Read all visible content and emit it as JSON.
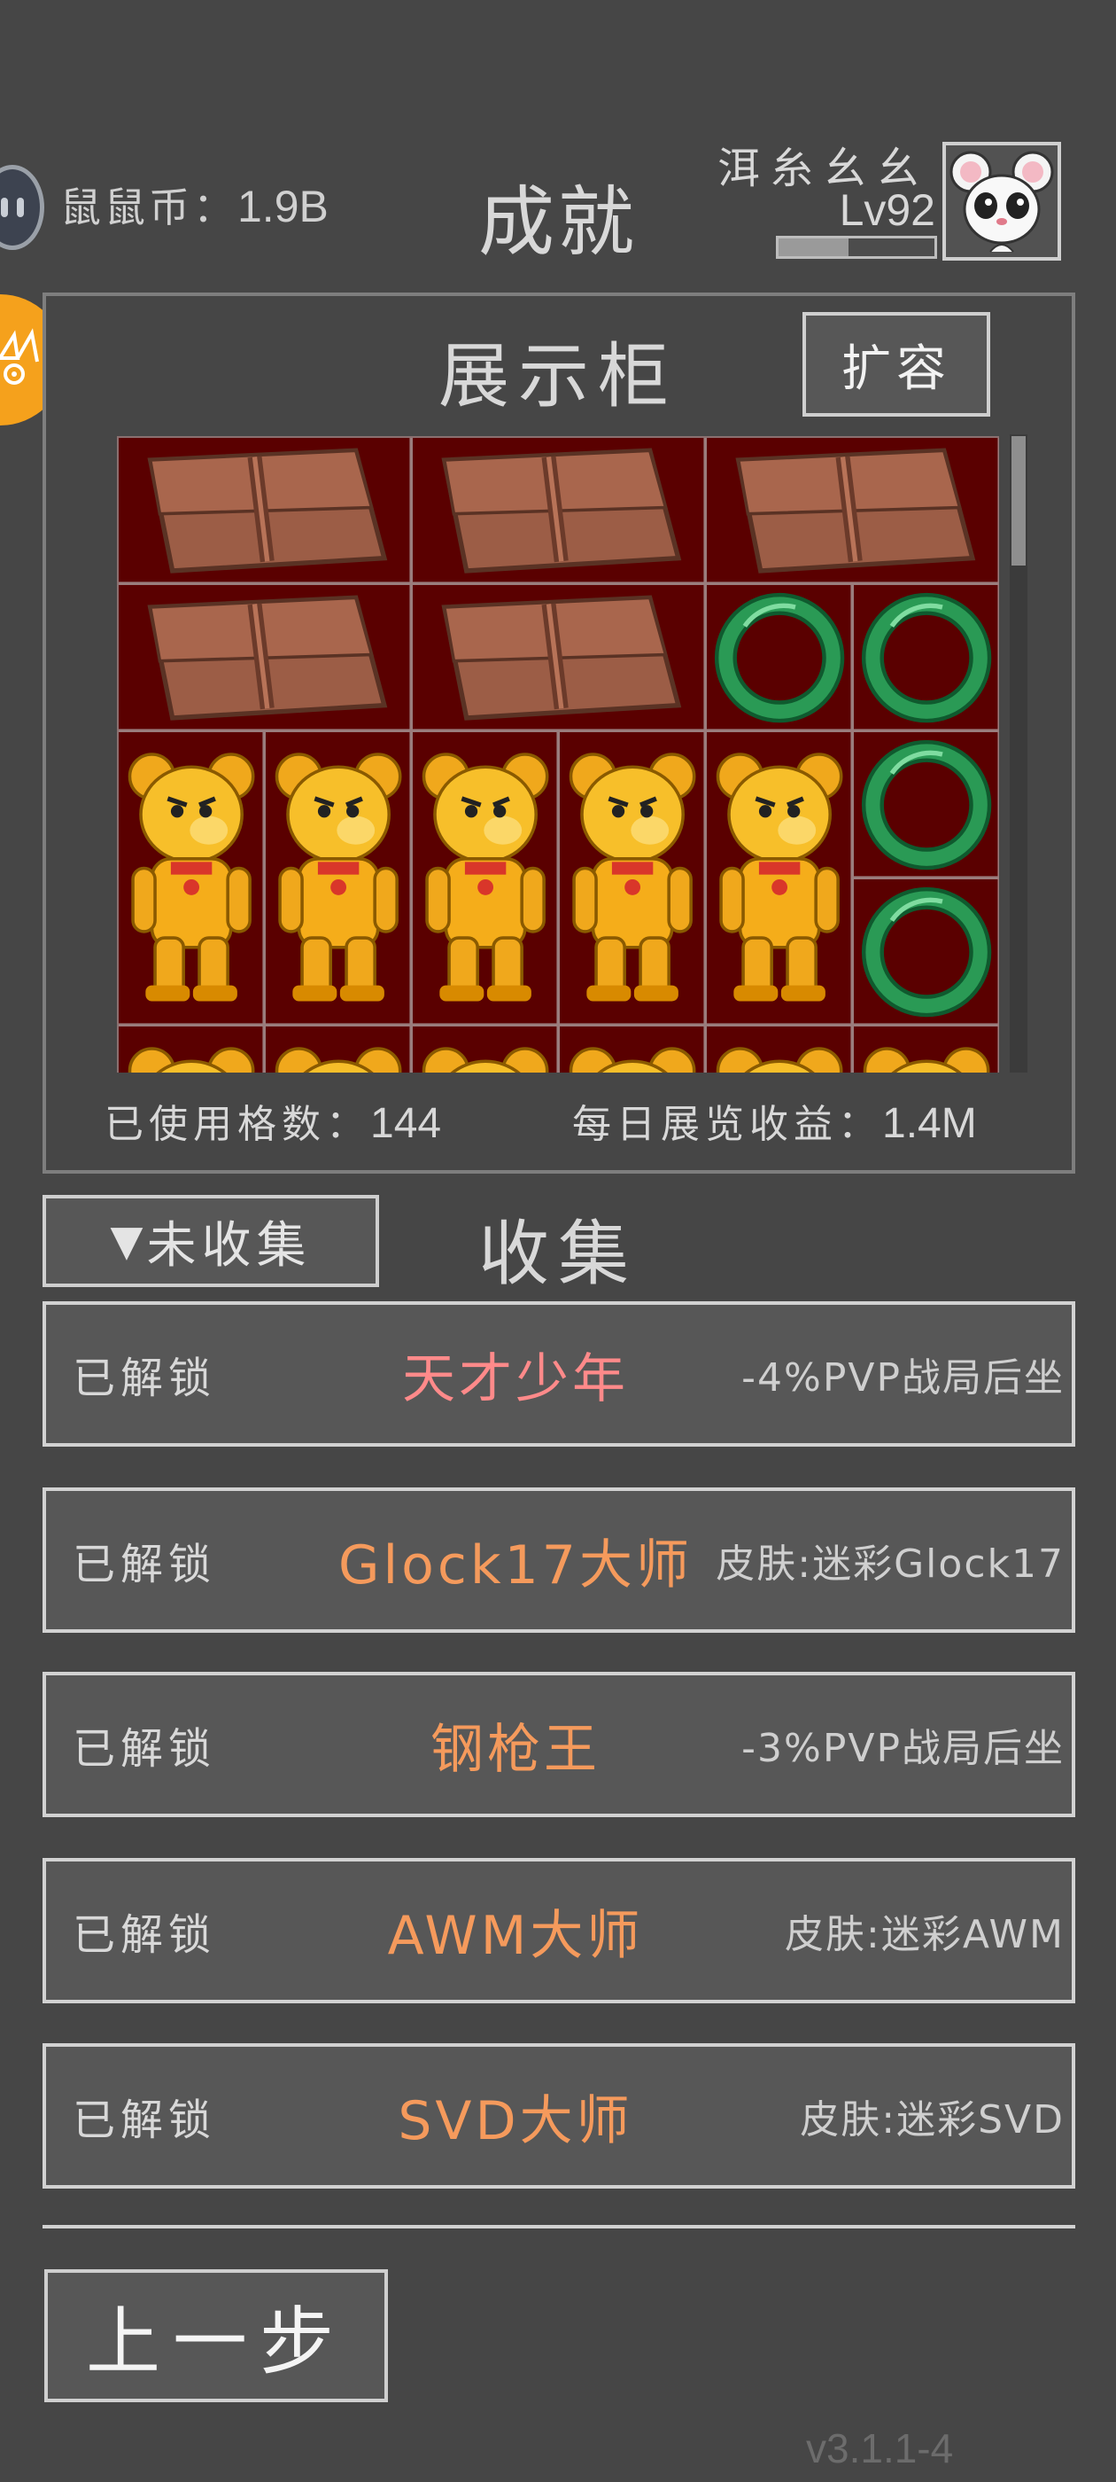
{
  "header": {
    "currency_label": "鼠鼠币：",
    "currency_value": "1.9B",
    "title": "成就",
    "player_name": "洱糸幺幺",
    "player_level": "Lv92",
    "xp_progress": 0.45
  },
  "showcase": {
    "title": "展示柜",
    "expand_label": "扩容",
    "used_slots_label": "已使用格数：",
    "used_slots_value": "144",
    "daily_income_label": "每日展览收益：",
    "daily_income_value": "1.4M",
    "scroll_position": 0.0
  },
  "collection": {
    "filter_arrow": "▼",
    "filter_label": "未收集",
    "title": "收集",
    "items": [
      {
        "status": "已解锁",
        "name": "天才少年",
        "reward": "-4%PVP战局后坐",
        "color": "#ff8a8a"
      },
      {
        "status": "已解锁",
        "name": "Glock17大师",
        "reward": "皮肤:迷彩Glock17",
        "color": "#f59a5c"
      },
      {
        "status": "已解锁",
        "name": "钢枪王",
        "reward": "-3%PVP战局后坐",
        "color": "#f59a5c"
      },
      {
        "status": "已解锁",
        "name": "AWM大师",
        "reward": "皮肤:迷彩AWM",
        "color": "#f59a5c"
      },
      {
        "status": "已解锁",
        "name": "SVD大师",
        "reward": "皮肤:迷彩SVD",
        "color": "#f59a5c"
      }
    ]
  },
  "footer": {
    "back_label": "上一步",
    "version": "v3.1.1-4"
  },
  "colors": {
    "background": "#464646",
    "grid_bg": "#5a0000",
    "accent_orange": "#f5a11c",
    "ring_green": "#1f8a4c",
    "bear_gold": "#f5b319",
    "wallet_brown": "#9a5a44"
  },
  "icons": {
    "coin": "mouse-coin-icon",
    "badge": "event-badge-icon",
    "avatar": "panda-mouse-avatar",
    "wallet": "leather-wallet-icon",
    "ring": "jade-bangle-icon",
    "bear": "golden-bear-icon"
  }
}
